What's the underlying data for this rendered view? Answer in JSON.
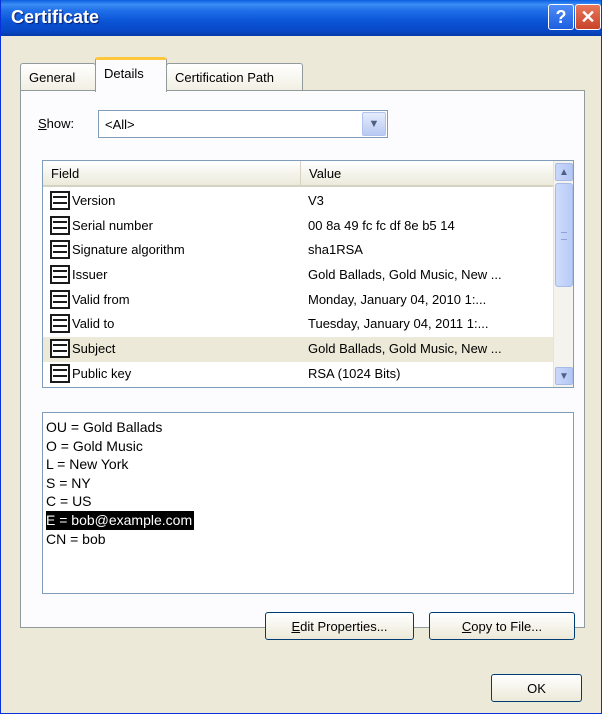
{
  "window": {
    "title": "Certificate"
  },
  "titlebar": {
    "help_glyph": "?",
    "close_glyph": "✕"
  },
  "tabs": [
    {
      "label": "General",
      "active": false
    },
    {
      "label": "Details",
      "active": true
    },
    {
      "label": "Certification Path",
      "active": false
    }
  ],
  "show": {
    "label_first": "S",
    "label_rest": "how:",
    "value": "<All>"
  },
  "list": {
    "columns": [
      "Field",
      "Value"
    ],
    "rows": [
      {
        "field": "Version",
        "value": "V3"
      },
      {
        "field": "Serial number",
        "value": "00 8a 49 fc fc df 8e b5 14"
      },
      {
        "field": "Signature algorithm",
        "value": "sha1RSA"
      },
      {
        "field": "Issuer",
        "value": "Gold Ballads, Gold Music, New ..."
      },
      {
        "field": "Valid from",
        "value": "Monday, January 04, 2010 1:..."
      },
      {
        "field": "Valid to",
        "value": "Tuesday, January 04, 2011 1:..."
      },
      {
        "field": "Subject",
        "value": "Gold Ballads, Gold Music, New ..."
      },
      {
        "field": "Public key",
        "value": "RSA (1024 Bits)"
      }
    ],
    "selected_row": 6
  },
  "detail": {
    "lines": [
      "OU = Gold Ballads",
      "O = Gold Music",
      "L = New York",
      "S = NY",
      "C = US",
      "E = bob@example.com",
      "CN = bob"
    ],
    "highlighted_line": 5
  },
  "buttons": {
    "edit_first": "E",
    "edit_rest": "dit Properties...",
    "copy_first": "C",
    "copy_rest": "opy to File...",
    "ok": "OK"
  },
  "colors": {
    "titlebar": "#0a53d6",
    "dialog_bg": "#ece9d8",
    "active_tab_accent": "#ffc83c",
    "selection_bg": "#000000"
  }
}
